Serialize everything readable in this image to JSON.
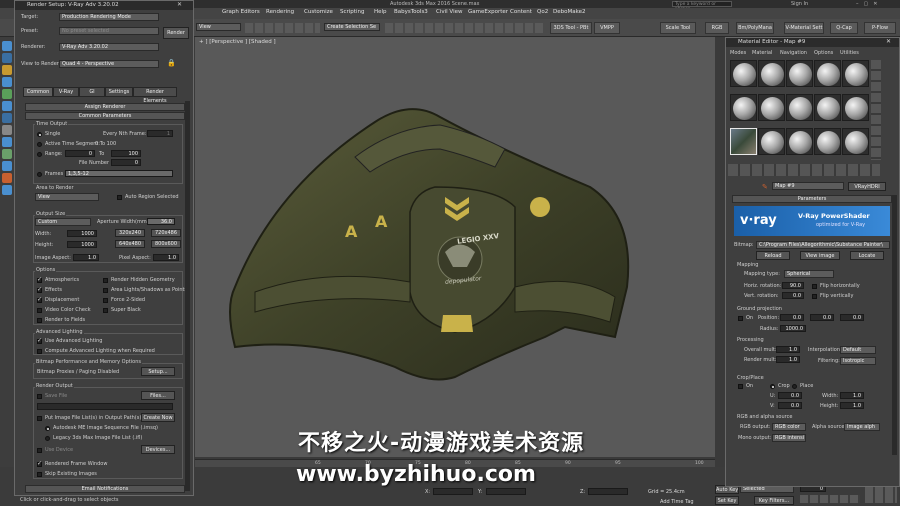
{
  "app": {
    "title": "Autodesk 3ds Max 2016    Scene.max",
    "search_placeholder": "Type a keyword or phrase",
    "sign_in": "Sign In"
  },
  "menu": [
    "Graph Editors",
    "Rendering",
    "Customize",
    "Scripting",
    "Help",
    "BabysTools3",
    "Civil View",
    "GameExporter",
    "Content",
    "Qo2",
    "DeboMake2"
  ],
  "toolbar": {
    "view_dropdown": "View",
    "selection_set": "Create Selection Se",
    "buttons": [
      "3DS Tool - PBt",
      "VMPP",
      "Scale Tool",
      "RGB",
      "Bm/PolyMana",
      "V-Material Sett",
      "Q-Cap",
      "P-Flow"
    ]
  },
  "viewport": {
    "label": "+ ] [Perspective ] [Shaded ]"
  },
  "render_setup": {
    "title": "Render Setup: V-Ray Adv 3.20.02",
    "target_label": "Target:",
    "target": "Production Rendering Mode",
    "preset_label": "Preset:",
    "preset": "No preset selected",
    "renderer_label": "Renderer:",
    "renderer": "V-Ray Adv 3.20.02",
    "render_button": "Render",
    "view_label": "View to Render:",
    "view": "Quad 4 - Perspective",
    "tabs": [
      "Common",
      "V-Ray",
      "GI",
      "Settings",
      "Render Elements"
    ],
    "assign_renderer": "Assign Renderer",
    "common_parameters": "Common Parameters",
    "time_output": "Time Output",
    "single": "Single",
    "every_nth": "Every Nth Frame:",
    "every_nth_val": "1",
    "active_segment": "Active Time Segment:",
    "active_segment_val": "0 To 100",
    "range": "Range:",
    "range_from": "0",
    "range_to_label": "To",
    "range_to": "100",
    "file_number_base": "File Number Base:",
    "file_number_base_val": "0",
    "frames": "Frames",
    "frames_val": "1,3,5-12",
    "area_to_render": "Area to Render",
    "area": "View",
    "auto_region": "Auto Region Selected",
    "output_size": "Output Size",
    "output_size_val": "Custom",
    "aperture_label": "Aperture Width(mm):",
    "aperture_val": "36.0",
    "width_label": "Width:",
    "width_val": "1000",
    "height_label": "Height:",
    "height_val": "1000",
    "presets": [
      "320x240",
      "720x486",
      "640x480",
      "800x600"
    ],
    "image_aspect": "Image Aspect:",
    "image_aspect_val": "1.0",
    "pixel_aspect": "Pixel Aspect:",
    "pixel_aspect_val": "1.0",
    "options": "Options",
    "atmospherics": "Atmospherics",
    "render_hidden": "Render Hidden Geometry",
    "effects": "Effects",
    "area_lights": "Area Lights/Shadows as Points",
    "displacement": "Displacement",
    "force_2sided": "Force 2-Sided",
    "video_color": "Video Color Check",
    "super_black": "Super Black",
    "render_fields": "Render to Fields",
    "advanced_lighting": "Advanced Lighting",
    "use_adv": "Use Advanced Lighting",
    "compute_adv": "Compute Advanced Lighting when Required",
    "bitmap_perf": "Bitmap Performance and Memory Options",
    "bitmap_proxies": "Bitmap Proxies / Paging Disabled",
    "setup": "Setup...",
    "render_output": "Render Output",
    "save_file": "Save File",
    "files": "Files...",
    "put_image": "Put Image File List(s) in Output Path(s)",
    "create_now": "Create Now",
    "autodesk_me": "Autodesk ME Image Sequence File (.imsq)",
    "legacy": "Legacy 3ds Max Image File List (.ifl)",
    "use_device": "Use Device",
    "devices": "Devices...",
    "rendered_frame": "Rendered Frame Window",
    "skip_existing": "Skip Existing Images",
    "email": "Email Notifications"
  },
  "material_editor": {
    "title": "Material Editor - Map #9",
    "menu": [
      "Modes",
      "Material",
      "Navigation",
      "Options",
      "Utilities"
    ],
    "map_name": "Map #9",
    "map_type": "VRayHDRI",
    "parameters": "Parameters",
    "vray_logo": "v·ray",
    "powershader": "V-Ray PowerShader",
    "optimized": "optimized for V-Ray",
    "bitmap_label": "Bitmap:",
    "bitmap_path": "C:\\Program Files\\Allegorithmic\\Substance Painter\\",
    "reload": "Reload",
    "view_image": "View image",
    "locate": "Locate",
    "mapping": "Mapping",
    "mapping_type_label": "Mapping type:",
    "mapping_type": "Spherical",
    "horiz_rot": "Horiz. rotation:",
    "horiz_val": "90.0",
    "flip_h": "Flip horizontally",
    "vert_rot": "Vert. rotation:",
    "vert_val": "0.0",
    "flip_v": "Flip vertically",
    "ground_proj": "Ground projection",
    "on": "On",
    "position": "Position:",
    "pos_vals": [
      "0.0",
      "0.0",
      "0.0"
    ],
    "radius": "Radius:",
    "radius_val": "1000.0",
    "processing": "Processing",
    "overall_mult": "Overall mult:",
    "overall_val": "1.0",
    "interpolation": "Interpolation:",
    "interp_val": "Default",
    "render_mult": "Render mult:",
    "render_val": "1.0",
    "filtering": "Filtering:",
    "filter_val": "Isotropic",
    "crop_place": "Crop/Place",
    "crop_on": "On",
    "crop": "Crop",
    "place": "Place",
    "u": "U:",
    "u_val": "0.0",
    "width": "Width:",
    "width_val": "1.0",
    "v": "V:",
    "v_val": "0.0",
    "height": "Height:",
    "height_val": "1.0",
    "rgb_alpha": "RGB and alpha source",
    "rgb_output": "RGB output:",
    "rgb_output_val": "RGB color",
    "alpha_source": "Alpha source:",
    "alpha_val": "Image alph",
    "mono_output": "Mono output:",
    "mono_val": "RGB intensi"
  },
  "bottom": {
    "status": "Click or click-and-drag to select objects",
    "x_label": "X:",
    "y_label": "Y:",
    "z_label": "Z:",
    "grid": "Grid = 25.4cm",
    "add_time_tag": "Add Time Tag",
    "auto_key": "Auto Key",
    "selected": "Selected",
    "set_key": "Set Key",
    "key_filters": "Key Filters...",
    "frame": "0",
    "ticks": [
      "65",
      "70",
      "75",
      "80",
      "85",
      "90",
      "95",
      "100"
    ],
    "frame_counter": "0 / 100"
  },
  "watermark": {
    "line1": "不移之火-动漫游戏美术资源",
    "line2": "www.byzhihuo.com"
  },
  "model": {
    "text": "LEGIO XXV",
    "sub": "depopulator"
  }
}
